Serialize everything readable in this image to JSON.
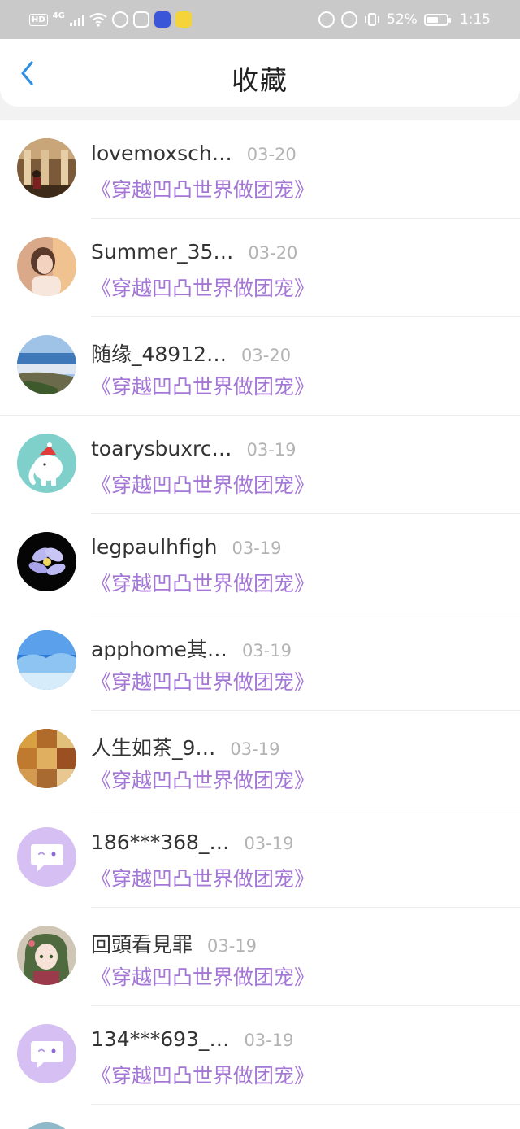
{
  "status_bar": {
    "hd": "HD",
    "network": "4G",
    "battery": "52%",
    "time": "1:15"
  },
  "header": {
    "title": "收藏"
  },
  "items": [
    {
      "username": "lovemoxsch…",
      "date": "03-20",
      "book": "《穿越凹凸世界做团宠》",
      "avatar": "photo-columns"
    },
    {
      "username": "Summer_35…",
      "date": "03-20",
      "book": "《穿越凹凸世界做团宠》",
      "avatar": "photo-girl"
    },
    {
      "username": "随缘_48912…",
      "date": "03-20",
      "book": "《穿越凹凸世界做团宠》",
      "avatar": "photo-sea"
    },
    {
      "username": "toarysbuxrc…",
      "date": "03-19",
      "book": "《穿越凹凸世界做团宠》",
      "avatar": "elephant"
    },
    {
      "username": "legpaulhfigh",
      "date": "03-19",
      "book": "《穿越凹凸世界做团宠》",
      "avatar": "photo-flower"
    },
    {
      "username": "apphome其…",
      "date": "03-19",
      "book": "《穿越凹凸世界做团宠》",
      "avatar": "photo-snow"
    },
    {
      "username": "人生如茶_9…",
      "date": "03-19",
      "book": "《穿越凹凸世界做团宠》",
      "avatar": "photo-food"
    },
    {
      "username": "186***368_…",
      "date": "03-19",
      "book": "《穿越凹凸世界做团宠》",
      "avatar": "default-chat"
    },
    {
      "username": "回頭看見罪",
      "date": "03-19",
      "book": "《穿越凹凸世界做团宠》",
      "avatar": "anime-girl"
    },
    {
      "username": "134***693_…",
      "date": "03-19",
      "book": "《穿越凹凸世界做团宠》",
      "avatar": "default-chat"
    }
  ],
  "colors": {
    "accent_blue": "#2f8fe6",
    "book_purple": "#a477d6",
    "default_avatar": "#d6c0f3"
  }
}
